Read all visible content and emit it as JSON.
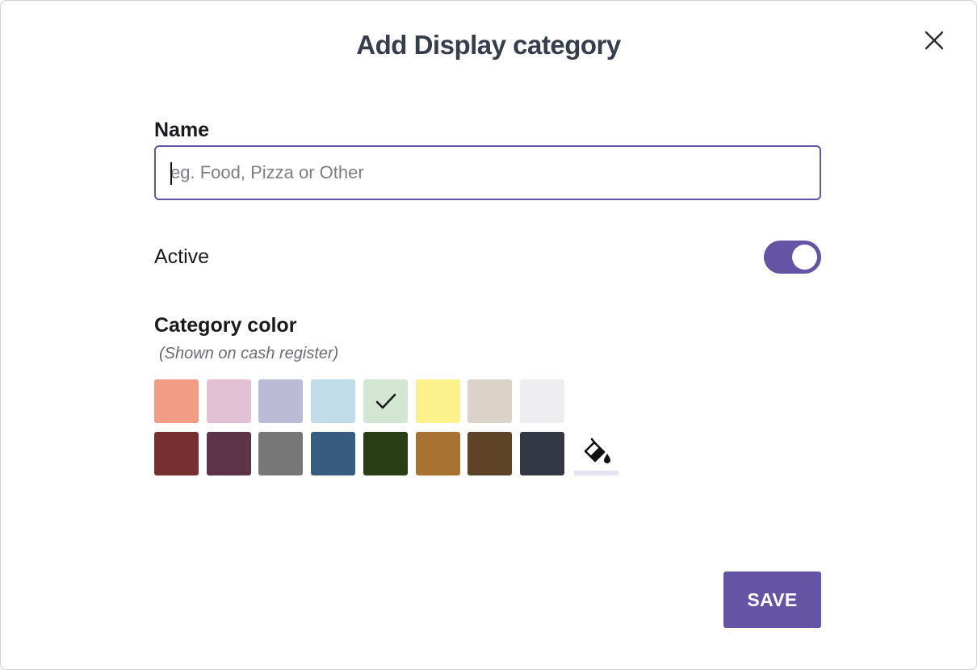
{
  "dialog": {
    "title": "Add Display category",
    "close_icon": "close-icon"
  },
  "name_field": {
    "label": "Name",
    "placeholder": "eg. Food, Pizza or Other",
    "value": ""
  },
  "active": {
    "label": "Active",
    "enabled": true,
    "color": "#6553a4"
  },
  "category_color": {
    "heading": "Category color",
    "subtitle": "(Shown on cash register)",
    "selected": "#d3e6d1",
    "swatches_row1": [
      "#f29c86",
      "#e1c1d3",
      "#bbbad7",
      "#c1dce9",
      "#d3e6d1",
      "#fbf28c",
      "#dcd3c8",
      "#eeeef0"
    ],
    "swatches_row2": [
      "#772f2f",
      "#5d3447",
      "#777777",
      "#385c80",
      "#2a3e16",
      "#a87233",
      "#5f4327",
      "#343844"
    ],
    "custom_icon": "paint-bucket-icon"
  },
  "actions": {
    "save_label": "SAVE",
    "save_color": "#6553a4"
  }
}
